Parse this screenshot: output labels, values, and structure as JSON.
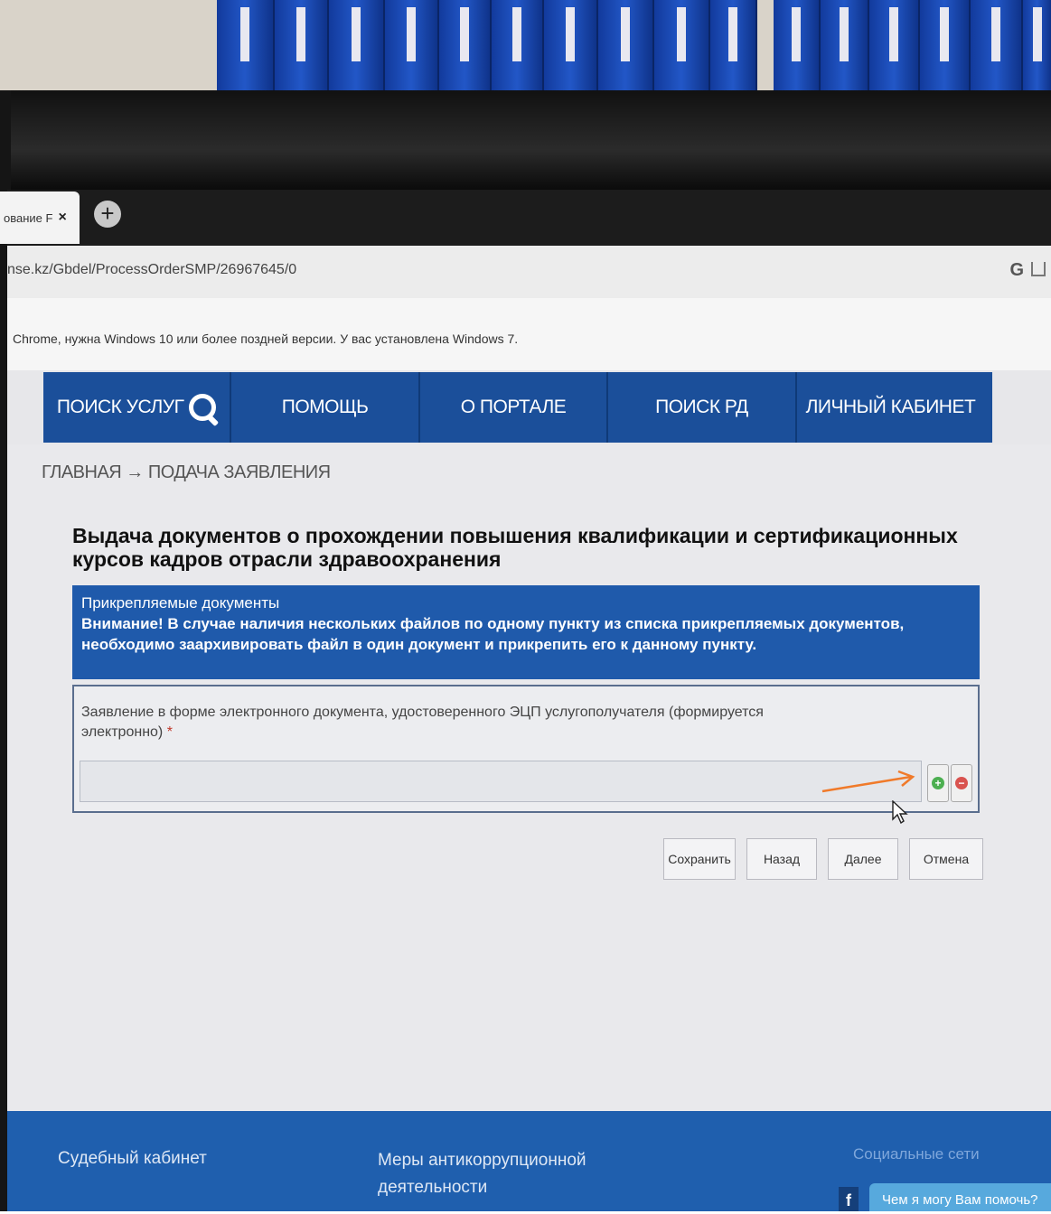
{
  "browser": {
    "tab_title": "ование F",
    "tab_close": "×",
    "new_tab": "+",
    "url": "nse.kz/Gbdel/ProcessOrderSMP/26967645/0",
    "g_label": "G",
    "info_message": "Chrome, нужна Windows 10 или более поздней версии. У вас установлена Windows 7."
  },
  "nav": {
    "items": [
      "ПОИСК УСЛУГ",
      "ПОМОЩЬ",
      "О ПОРТАЛЕ",
      "ПОИСК РД",
      "ЛИЧНЫЙ КАБИНЕТ"
    ]
  },
  "page": {
    "breadcrumb": "ГЛАВНАЯ → ПОДАЧА ЗАЯВЛЕНИЯ",
    "title": "Выдача документов о прохождении повышения квалификации и сертификационных курсов кадров отрасли здравоохранения"
  },
  "attachments": {
    "header": "Прикрепляемые документы",
    "warning": "Внимание! В случае наличия нескольких файлов по одному пункту из списка прикрепляемых документов, необходимо заархивировать файл в один документ и прикрепить его к данному пункту.",
    "field_label": "Заявление в форме электронного документа, удостоверенного ЭЦП услугополучателя (формируется электронно)",
    "required_mark": "*",
    "add_symbol": "+",
    "remove_symbol": "−"
  },
  "actions": {
    "save": "Сохранить",
    "back": "Назад",
    "next": "Далее",
    "cancel": "Отмена"
  },
  "footer": {
    "court_cabinet": "Судебный кабинет",
    "anticorruption": "Меры антикоррупционной деятельности",
    "social": "Социальные сети",
    "facebook": "f",
    "help_chat": "Чем я могу Вам помочь?"
  },
  "colors": {
    "nav_blue": "#1b4f9a",
    "panel_blue": "#1f5aab",
    "footer_blue": "#1f5fae",
    "annotation_arrow": "#f07a2a"
  }
}
